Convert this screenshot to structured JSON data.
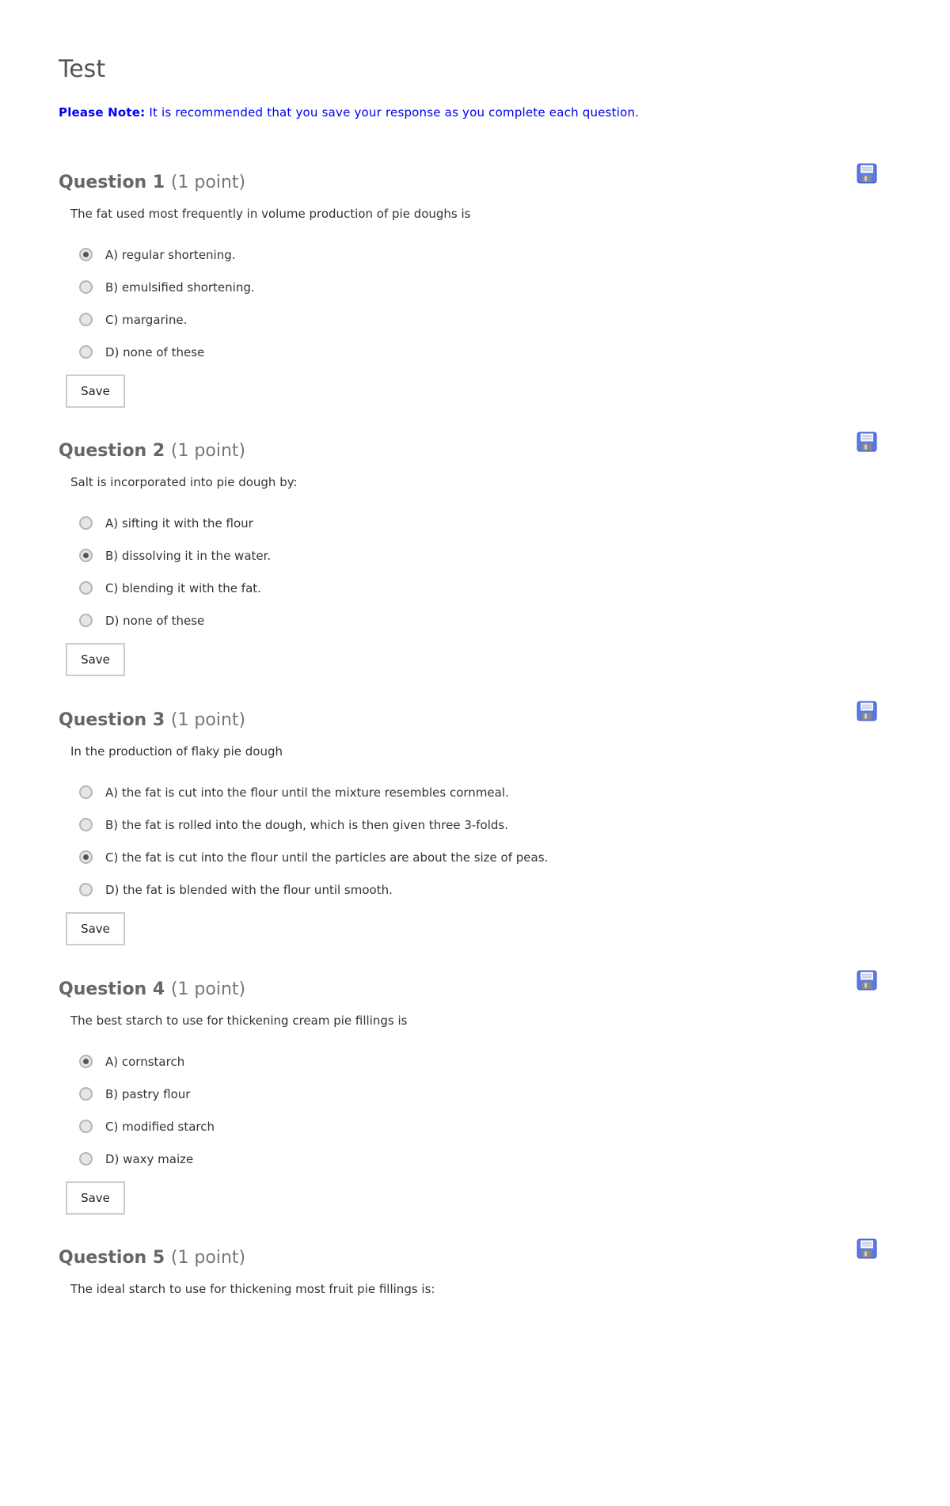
{
  "page": {
    "title": "Test",
    "note_label": "Please Note:",
    "note_text": " It is recommended that you save your response as you complete each question.",
    "accent_color": "#0000ee"
  },
  "questions": [
    {
      "heading": "Question 1",
      "points": "(1 point)",
      "text": "The fat used most frequently in volume production of pie doughs is",
      "options": [
        "A) regular shortening.",
        "B) emulsified shortening.",
        "C) margarine.",
        "D) none of these"
      ],
      "selected": 0,
      "save_label": "Save",
      "icon": "floppy-disk-icon"
    },
    {
      "heading": "Question 2",
      "points": "(1 point)",
      "text": "Salt is incorporated into pie dough by:",
      "options": [
        "A) sifting it with the flour",
        "B) dissolving it in the water.",
        "C) blending it with the fat.",
        "D) none of these"
      ],
      "selected": 1,
      "save_label": "Save",
      "icon": "floppy-disk-icon"
    },
    {
      "heading": "Question 3",
      "points": "(1 point)",
      "text": "In the production of flaky pie dough",
      "options": [
        "A) the fat is cut into the flour until the mixture resembles cornmeal.",
        "B) the fat is rolled into the dough, which is then given three 3-folds.",
        "C) the fat is cut into the flour until the particles are about the size of peas.",
        "D) the fat is blended with the flour until smooth."
      ],
      "selected": 2,
      "save_label": "Save",
      "icon": "floppy-disk-icon"
    },
    {
      "heading": "Question 4",
      "points": "(1 point)",
      "text": "The best starch to use for thickening cream pie fillings is",
      "options": [
        "A) cornstarch",
        "B) pastry flour",
        "C) modified starch",
        "D) waxy maize"
      ],
      "selected": 0,
      "save_label": "Save",
      "icon": "floppy-disk-icon"
    },
    {
      "heading": "Question 5",
      "points": "(1 point)",
      "text": "The ideal starch to use for thickening most fruit pie fillings is:",
      "options": [],
      "selected": null,
      "save_label": null,
      "icon": "floppy-disk-icon"
    }
  ]
}
